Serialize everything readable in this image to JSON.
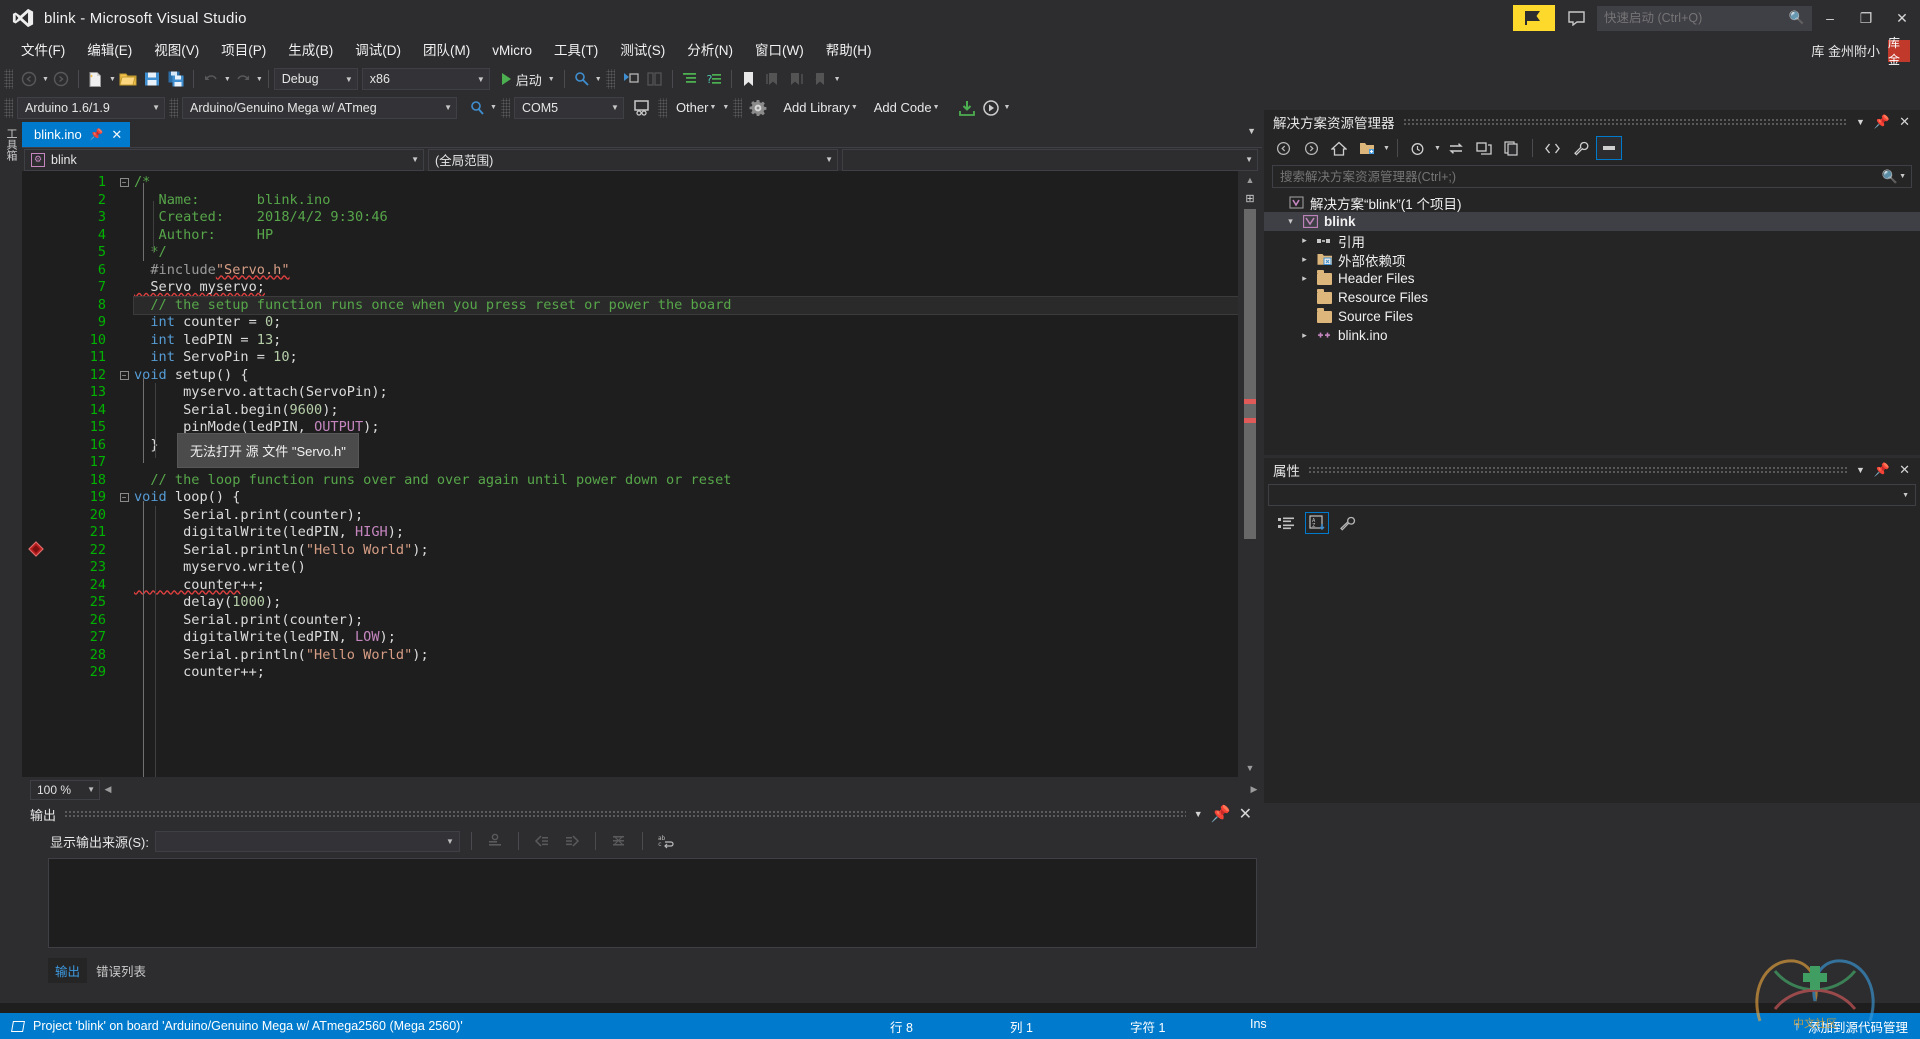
{
  "window": {
    "title": "blink - Microsoft Visual Studio",
    "logo_icon": "visual-studio-logo",
    "minimize": "–",
    "maximize": "❐",
    "close": "✕"
  },
  "titlebar": {
    "flag_icon": "flag-icon",
    "feedback_icon": "feedback-icon",
    "quick_launch_placeholder": "快速启动 (Ctrl+Q)",
    "quick_launch_value": "",
    "search_icon": "search-icon"
  },
  "menu": {
    "items": [
      "文件(F)",
      "编辑(E)",
      "视图(V)",
      "项目(P)",
      "生成(B)",
      "调试(D)",
      "团队(M)",
      "vMicro",
      "工具(T)",
      "测试(S)",
      "分析(N)",
      "窗口(W)",
      "帮助(H)"
    ],
    "user": "库 金州附小",
    "avatar_text": "库金"
  },
  "toolbar_main": {
    "nav_back_icon": "navigate-back-icon",
    "nav_forward_icon": "navigate-forward-icon",
    "new_item_icon": "new-item-icon",
    "open_file_icon": "open-file-icon",
    "save_icon": "save-icon",
    "save_all_icon": "save-all-icon",
    "undo_icon": "undo-icon",
    "redo_icon": "redo-icon",
    "config_value": "Debug",
    "platform_value": "x86",
    "run_label": "启动",
    "run_icon": "play-icon",
    "attach_icon": "attach-to-process-icon",
    "step_icon": "step-into-icon",
    "columns_icon": "columns-icon",
    "indent_icon": "indent-icon",
    "comment_icon": "comment-icon",
    "bookmark_icon": "bookmark-icon",
    "prev_bookmark_icon": "previous-bookmark-icon",
    "next_bookmark_icon": "next-bookmark-icon",
    "clear_bookmark_icon": "clear-bookmarks-icon"
  },
  "toolbar_vmicro": {
    "version_value": "Arduino 1.6/1.9",
    "board_value": "Arduino/Genuino Mega w/ ATmeg",
    "search_icon": "magnifier-icon",
    "port_value": "COM5",
    "serial_monitor_icon": "serial-monitor-icon",
    "other_label": "Other",
    "settings_icon": "gear-icon",
    "add_library_label": "Add Library",
    "add_code_label": "Add Code",
    "download_icon": "download-icon",
    "upload_icon": "upload-icon"
  },
  "left_edge": {
    "tabs": [
      "工具箱"
    ]
  },
  "editor": {
    "tab_name": "blink.ino",
    "tab_pin_icon": "pin-icon",
    "tab_close_icon": "close-icon",
    "scope_left": "blink",
    "scope_right": "(全局范围)",
    "zoom": "100 %",
    "error_tooltip": "无法打开 源 文件 \"Servo.h\"",
    "lines": [
      {
        "n": 1,
        "fold": "minus",
        "indent": 0,
        "tokens": [
          {
            "t": "/*",
            "c": "cm"
          }
        ]
      },
      {
        "n": 2,
        "fold": "",
        "indent": 0,
        "tokens": [
          {
            "t": "   Name:       blink.ino",
            "c": "cm"
          }
        ]
      },
      {
        "n": 3,
        "fold": "",
        "indent": 0,
        "tokens": [
          {
            "t": "   Created:    2018/4/2 9:30:46",
            "c": "cm"
          }
        ]
      },
      {
        "n": 4,
        "fold": "",
        "indent": 0,
        "tokens": [
          {
            "t": "   Author:     HP",
            "c": "cm"
          }
        ]
      },
      {
        "n": 5,
        "fold": "",
        "indent": 0,
        "tokens": [
          {
            "t": "  */",
            "c": "cm"
          }
        ]
      },
      {
        "n": 6,
        "fold": "",
        "indent": 0,
        "tokens": [
          {
            "t": "  #include",
            "c": "pp"
          },
          {
            "t": "\"Servo.h\"",
            "c": "str sq"
          }
        ]
      },
      {
        "n": 7,
        "fold": "",
        "indent": 0,
        "tokens": [
          {
            "t": "  Servo myservo;",
            "c": "id sq"
          }
        ]
      },
      {
        "n": 8,
        "fold": "",
        "indent": 0,
        "cur": true,
        "tokens": [
          {
            "t": "  // the setup function runs once when you press reset or power the board",
            "c": "cm"
          }
        ]
      },
      {
        "n": 9,
        "fold": "",
        "indent": 0,
        "tokens": [
          {
            "t": "  int",
            "c": "k"
          },
          {
            "t": " counter = ",
            "c": "id"
          },
          {
            "t": "0",
            "c": "num"
          },
          {
            "t": ";",
            "c": "id"
          }
        ]
      },
      {
        "n": 10,
        "fold": "",
        "indent": 0,
        "tokens": [
          {
            "t": "  int",
            "c": "k"
          },
          {
            "t": " ledPIN = ",
            "c": "id"
          },
          {
            "t": "13",
            "c": "num"
          },
          {
            "t": ";",
            "c": "id"
          }
        ]
      },
      {
        "n": 11,
        "fold": "",
        "indent": 0,
        "tokens": [
          {
            "t": "  int",
            "c": "k"
          },
          {
            "t": " ServoPin = ",
            "c": "id"
          },
          {
            "t": "10",
            "c": "num"
          },
          {
            "t": ";",
            "c": "id"
          }
        ]
      },
      {
        "n": 12,
        "fold": "minus",
        "indent": 0,
        "tokens": [
          {
            "t": "void",
            "c": "k"
          },
          {
            "t": " setup() {",
            "c": "id"
          }
        ]
      },
      {
        "n": 13,
        "fold": "",
        "indent": 1,
        "tokens": [
          {
            "t": "      myservo.attach(ServoPin);",
            "c": "id"
          }
        ]
      },
      {
        "n": 14,
        "fold": "",
        "indent": 1,
        "tokens": [
          {
            "t": "      Serial.begin(",
            "c": "id"
          },
          {
            "t": "9600",
            "c": "num"
          },
          {
            "t": ");",
            "c": "id"
          }
        ]
      },
      {
        "n": 15,
        "fold": "",
        "indent": 1,
        "tokens": [
          {
            "t": "      pinMode(ledPIN, ",
            "c": "id"
          },
          {
            "t": "OUTPUT",
            "c": "mac"
          },
          {
            "t": ");",
            "c": "id"
          }
        ]
      },
      {
        "n": 16,
        "fold": "",
        "indent": 1,
        "tokens": [
          {
            "t": "  }",
            "c": "id"
          }
        ]
      },
      {
        "n": 17,
        "fold": "",
        "indent": 0,
        "tokens": [
          {
            "t": "",
            "c": "id"
          }
        ]
      },
      {
        "n": 18,
        "fold": "",
        "indent": 0,
        "tokens": [
          {
            "t": "  // the loop function runs over and over again until power down or reset",
            "c": "cm"
          }
        ]
      },
      {
        "n": 19,
        "fold": "minus",
        "indent": 0,
        "tokens": [
          {
            "t": "void",
            "c": "k"
          },
          {
            "t": " loop() {",
            "c": "id"
          }
        ]
      },
      {
        "n": 20,
        "fold": "",
        "indent": 1,
        "tokens": [
          {
            "t": "      Serial.print(counter);",
            "c": "id"
          }
        ]
      },
      {
        "n": 21,
        "fold": "",
        "indent": 1,
        "tokens": [
          {
            "t": "      digitalWrite(ledPIN, ",
            "c": "id"
          },
          {
            "t": "HIGH",
            "c": "mac"
          },
          {
            "t": ");",
            "c": "id"
          }
        ]
      },
      {
        "n": 22,
        "fold": "",
        "indent": 1,
        "tokens": [
          {
            "t": "      Serial.println(",
            "c": "id"
          },
          {
            "t": "\"Hello World\"",
            "c": "str"
          },
          {
            "t": ");",
            "c": "id"
          }
        ]
      },
      {
        "n": 23,
        "fold": "",
        "indent": 1,
        "tokens": [
          {
            "t": "      myservo.write()",
            "c": "id"
          }
        ]
      },
      {
        "n": 24,
        "fold": "",
        "indent": 1,
        "tokens": [
          {
            "t": "      counter",
            "c": "id sq"
          },
          {
            "t": "++;",
            "c": "id"
          }
        ]
      },
      {
        "n": 25,
        "fold": "",
        "indent": 1,
        "tokens": [
          {
            "t": "      delay(",
            "c": "id"
          },
          {
            "t": "1000",
            "c": "num"
          },
          {
            "t": ");",
            "c": "id"
          }
        ]
      },
      {
        "n": 26,
        "fold": "",
        "indent": 1,
        "tokens": [
          {
            "t": "      Serial.print(counter);",
            "c": "id"
          }
        ]
      },
      {
        "n": 27,
        "fold": "",
        "indent": 1,
        "tokens": [
          {
            "t": "      digitalWrite(ledPIN, ",
            "c": "id"
          },
          {
            "t": "LOW",
            "c": "mac"
          },
          {
            "t": ");",
            "c": "id"
          }
        ]
      },
      {
        "n": 28,
        "fold": "",
        "indent": 1,
        "tokens": [
          {
            "t": "      Serial.println(",
            "c": "id"
          },
          {
            "t": "\"Hello World\"",
            "c": "str"
          },
          {
            "t": ");",
            "c": "id"
          }
        ]
      },
      {
        "n": 29,
        "fold": "",
        "indent": 1,
        "tokens": [
          {
            "t": "      counter++;",
            "c": "id"
          }
        ]
      }
    ]
  },
  "output_panel": {
    "title": "输出",
    "source_label": "显示输出来源(S):",
    "source_value": "",
    "tabs": [
      {
        "label": "输出",
        "active": true
      },
      {
        "label": "错误列表",
        "active": false
      }
    ],
    "dropdown_icon": "chevron-down-icon",
    "pin_icon": "pin-icon",
    "close_icon": "close-icon",
    "tool_icons": [
      "find-message-icon",
      "go-to-previous-icon",
      "go-to-next-icon",
      "clear-all-icon",
      "toggle-word-wrap-icon"
    ]
  },
  "solution_explorer": {
    "title": "解决方案资源管理器",
    "search_placeholder": "搜索解决方案资源管理器(Ctrl+;)",
    "search_value": "",
    "toolbar_icons": [
      "back-icon",
      "forward-icon",
      "home-icon",
      "new-folder-icon",
      "dropdown-icon",
      "pending-changes-icon",
      "sync-icon",
      "collapse-all-icon",
      "show-all-files-icon",
      "properties-code-icon",
      "wrench-icon",
      "properties-window-icon"
    ],
    "tree": [
      {
        "label": "解决方案“blink”(1 个项目)",
        "arrow": "",
        "icon": "solution-icon",
        "depth": 0,
        "selected": false,
        "bold": false
      },
      {
        "label": "blink",
        "arrow": "▾",
        "icon": "project-icon",
        "depth": 1,
        "selected": true,
        "bold": true
      },
      {
        "label": "引用",
        "arrow": "▸",
        "icon": "references-icon",
        "depth": 2,
        "selected": false,
        "bold": false
      },
      {
        "label": "外部依赖项",
        "arrow": "▸",
        "icon": "external-deps-icon",
        "depth": 2,
        "selected": false,
        "bold": false
      },
      {
        "label": "Header Files",
        "arrow": "▸",
        "icon": "folder-icon",
        "depth": 2,
        "selected": false,
        "bold": false
      },
      {
        "label": "Resource Files",
        "arrow": "",
        "icon": "folder-icon",
        "depth": 2,
        "selected": false,
        "bold": false
      },
      {
        "label": "Source Files",
        "arrow": "",
        "icon": "folder-icon",
        "depth": 2,
        "selected": false,
        "bold": false
      },
      {
        "label": "blink.ino",
        "arrow": "▸",
        "icon": "cpp-file-icon",
        "depth": 2,
        "selected": false,
        "bold": false
      }
    ]
  },
  "properties_panel": {
    "title": "属性",
    "combo_value": "",
    "toolbar_icons": [
      "categorized-icon",
      "alphabetical-icon",
      "property-pages-icon"
    ],
    "dropdown_icon": "chevron-down-icon",
    "pin_icon": "pin-icon",
    "close_icon": "close-icon"
  },
  "status_bar": {
    "message": "Project 'blink' on board 'Arduino/Genuino Mega w/ ATmega2560 (Mega 2560)'",
    "row_label": "行 8",
    "col_label": "列 1",
    "char_label": "字符 1",
    "insert_mode": "Ins",
    "publish_icon": "up-arrow-icon",
    "publish_label": "添加到源代码管理",
    "watermark": "中文社区"
  },
  "colors": {
    "accent": "#007acc",
    "title_bg": "#2d2d30",
    "editor_bg": "#1e1e1e",
    "panel_bg": "#252526",
    "comment_green": "#57a64a",
    "keyword_blue": "#569cd6",
    "string_orange": "#d69d85",
    "macro_purple": "#c586c0",
    "linenum_green": "#00b300",
    "error_red": "#e04040"
  }
}
